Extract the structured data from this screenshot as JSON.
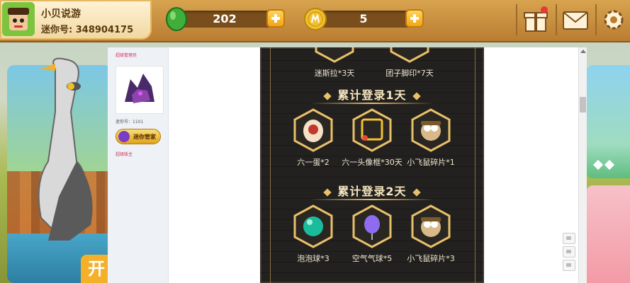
{
  "player": {
    "name": "小贝说游",
    "id_text": "迷你号: 348904175"
  },
  "currency": {
    "gems": "202",
    "coins": "5"
  },
  "sidebar": {
    "title": "超级管理员",
    "mini_id": "迷你号：1101",
    "badge": "迷你管家",
    "role": "超级版主"
  },
  "event": {
    "top_rewards": [
      {
        "label": "迷斯拉*3天"
      },
      {
        "label": "团子脚印*7天"
      }
    ],
    "day1_title": "累计登录1天",
    "day1_rewards": [
      {
        "label": "六一蛋*2"
      },
      {
        "label": "六一头像框*30天"
      },
      {
        "label": "小飞鼠碎片*1"
      }
    ],
    "day2_title": "累计登录2天",
    "day2_rewards": [
      {
        "label": "泡泡球*3"
      },
      {
        "label": "空气气球*5"
      },
      {
        "label": "小飞鼠碎片*3"
      }
    ]
  },
  "banner": {
    "text": "开"
  },
  "colors": {
    "hud_gold": "#d8a34f",
    "event_bg": "#1f1d1b",
    "accent_gold": "#e8c06a"
  }
}
